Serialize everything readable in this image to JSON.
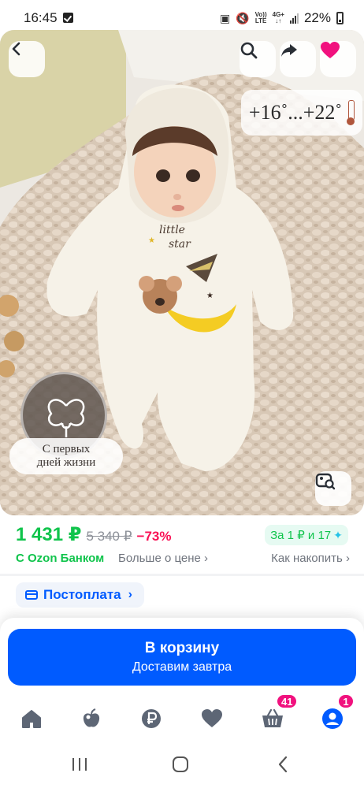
{
  "status_bar": {
    "time": "16:45",
    "network_top": "Vo))",
    "network_bottom": "LTE",
    "network2_top": "4G+",
    "network2_bottom": "↓↑",
    "battery": "22%"
  },
  "product_image": {
    "temperature": "+16˚...+22˚",
    "cotton_label_line1": "С первых",
    "cotton_label_line2": "дней жизни",
    "print_text_1": "little",
    "print_text_2": "star"
  },
  "price": {
    "current": "1 431 ₽",
    "old": "5 340 ₽",
    "discount": "−73%",
    "bonus": "За 1 ₽ и 17"
  },
  "info": {
    "ozon_bank": "С Ozon Банком",
    "more_price": "Больше о цене ›",
    "how_accumulate": "Как накопить ›"
  },
  "postpay": {
    "label": "Постоплата"
  },
  "cart": {
    "title": "В корзину",
    "subtitle": "Доставим завтра"
  },
  "bottom_nav": {
    "cart_badge": "41",
    "profile_badge": "1"
  },
  "colors": {
    "accent_blue": "#005bff",
    "price_green": "#10c44c",
    "discount_red": "#f91155",
    "badge_pink": "#f1117e"
  }
}
